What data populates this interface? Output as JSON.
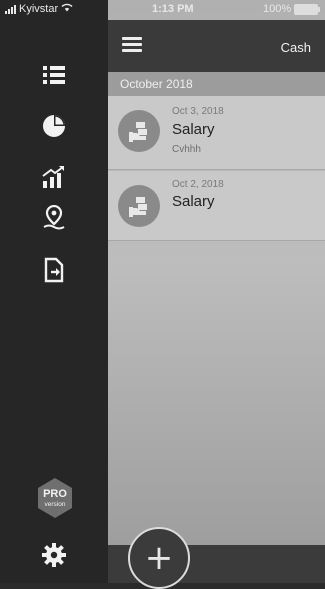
{
  "status_bar": {
    "carrier": "Kyivstar",
    "time": "1:13 PM",
    "battery": "100%"
  },
  "sidebar": {
    "items": [
      {
        "icon": "list-icon"
      },
      {
        "icon": "pie-chart-icon"
      },
      {
        "icon": "trend-chart-icon"
      },
      {
        "icon": "map-pin-icon"
      },
      {
        "icon": "export-document-icon"
      }
    ],
    "pro_badge": {
      "line1": "PRO",
      "line2": "version"
    },
    "settings_icon": "gear-icon"
  },
  "header": {
    "title": "Cash"
  },
  "transactions": {
    "group_label": "October 2018",
    "items": [
      {
        "date": "Oct 3, 2018",
        "title": "Salary",
        "note": "Cvhhh",
        "icon": "money-hand-icon"
      },
      {
        "date": "Oct 2, 2018",
        "title": "Salary",
        "icon": "money-hand-icon"
      }
    ]
  },
  "fab": {
    "label": "+"
  }
}
